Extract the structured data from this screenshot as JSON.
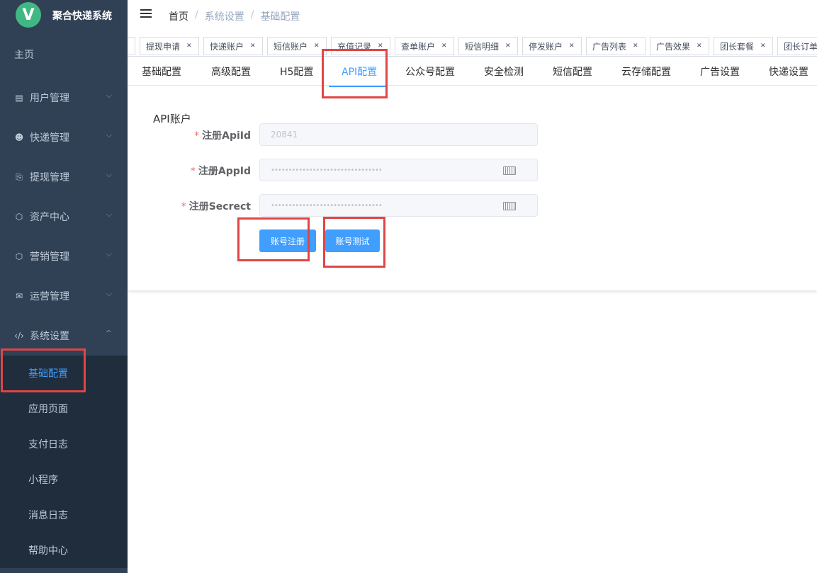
{
  "app": {
    "logo_letter": "V",
    "title": "聚合快递系统"
  },
  "sidebar": {
    "home": "主页",
    "items": [
      {
        "label": "用户管理",
        "icon": "list-icon"
      },
      {
        "label": "快递管理",
        "icon": "courier-icon"
      },
      {
        "label": "提现管理",
        "icon": "withdraw-icon"
      },
      {
        "label": "资产中心",
        "icon": "cube-icon"
      },
      {
        "label": "营销管理",
        "icon": "cube-icon"
      },
      {
        "label": "运营管理",
        "icon": "mail-icon"
      },
      {
        "label": "系统设置",
        "icon": "code-icon"
      }
    ],
    "submenu": [
      "基础配置",
      "应用页面",
      "支付日志",
      "小程序",
      "消息日志",
      "帮助中心"
    ],
    "active_sub": "基础配置"
  },
  "breadcrumb": [
    "首页",
    "系统设置",
    "基础配置"
  ],
  "tags": [
    "提现申请",
    "快递账户",
    "短信账户",
    "充值记录",
    "查单账户",
    "短信明细",
    "停发账户",
    "广告列表",
    "广告效果",
    "团长套餐",
    "团长订单"
  ],
  "tabs": [
    "基础配置",
    "高级配置",
    "H5配置",
    "API配置",
    "公众号配置",
    "安全检测",
    "短信配置",
    "云存储配置",
    "广告设置",
    "快递设置"
  ],
  "active_tab": "API配置",
  "form": {
    "section_title": "API账户",
    "fields": [
      {
        "label": "注册ApiId",
        "value": "20841"
      },
      {
        "label": "注册AppId",
        "value": "••••••••••••••••••••••••••••••••"
      },
      {
        "label": "注册Secrect",
        "value": "••••••••••••••••••••••••••••••••"
      }
    ],
    "register_button": "账号注册",
    "test_button": "账号测试"
  },
  "colors": {
    "sidebar_bg": "#304156",
    "submenu_bg": "#1f2d3d",
    "accent": "#409eff",
    "highlight": "#e14545"
  }
}
